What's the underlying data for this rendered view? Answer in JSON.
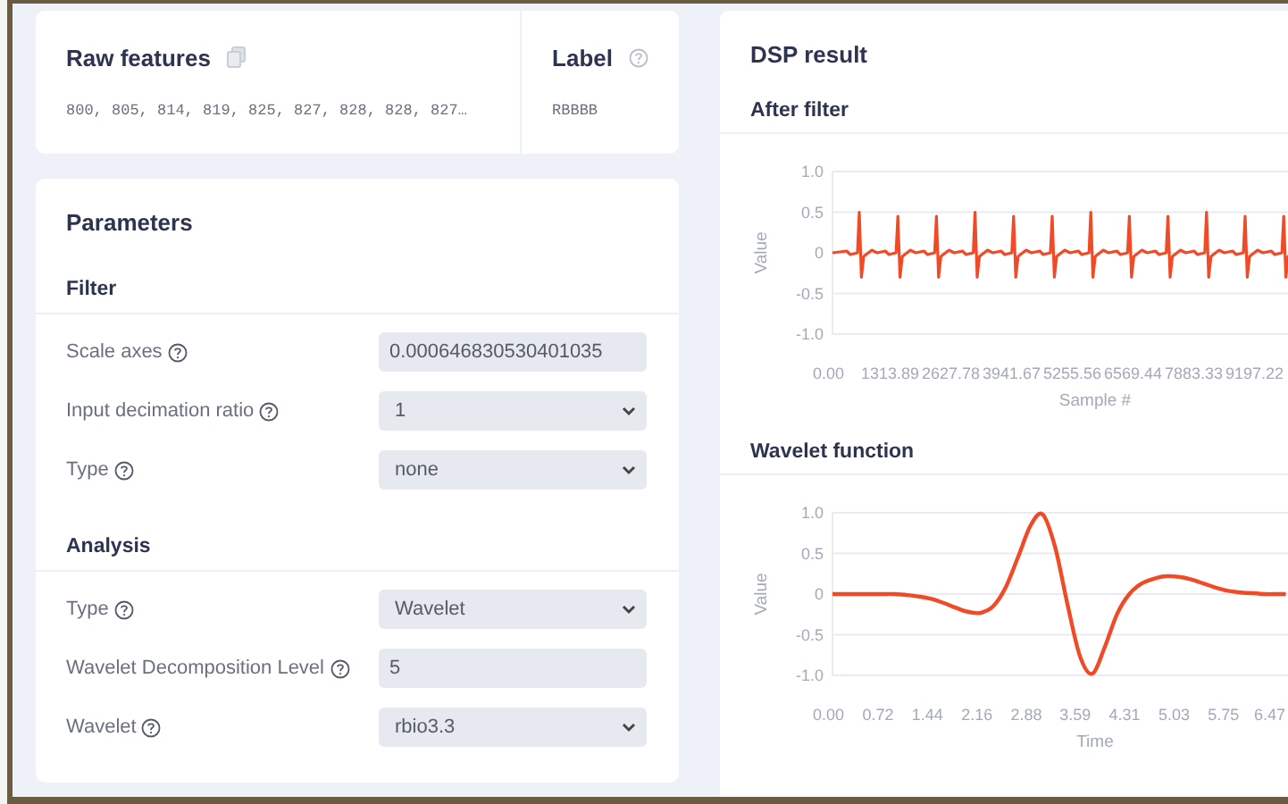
{
  "raw_features": {
    "title": "Raw features",
    "values": "800, 805, 814, 819, 825, 827, 828, 828, 827…"
  },
  "label": {
    "title": "Label",
    "value": "RBBBB"
  },
  "parameters": {
    "title": "Parameters",
    "sections": [
      {
        "title": "Filter",
        "fields": [
          {
            "label": "Scale axes",
            "kind": "input",
            "value": "0.000646830530401035"
          },
          {
            "label": "Input decimation ratio",
            "kind": "select",
            "value": "1"
          },
          {
            "label": "Type",
            "kind": "select",
            "value": "none"
          }
        ]
      },
      {
        "title": "Analysis",
        "fields": [
          {
            "label": "Type",
            "kind": "select",
            "value": "Wavelet"
          },
          {
            "label": "Wavelet Decomposition Level",
            "kind": "input",
            "value": "5"
          },
          {
            "label": "Wavelet",
            "kind": "select",
            "value": "rbio3.3"
          }
        ]
      }
    ]
  },
  "dsp_result": {
    "title": "DSP result",
    "charts": [
      {
        "title": "After filter",
        "kind": "ecg",
        "ylabel": "Value",
        "yticks": [
          "1.0",
          "0.5",
          "0",
          "-0.5",
          "-1.0"
        ],
        "xticks": [
          "0.00",
          "1313.89",
          "2627.78",
          "3941.67",
          "5255.56",
          "6569.44",
          "7883.33",
          "9197.22"
        ],
        "xlabel": "Sample #"
      },
      {
        "title": "Wavelet function",
        "chart_data": {
          "type": "line",
          "xlabel": "Time",
          "ylabel": "Value",
          "grid": true,
          "x": [
            0,
            0.18,
            0.36,
            0.54,
            0.72,
            0.9,
            1.08,
            1.26,
            1.44,
            1.62,
            1.8,
            1.98,
            2.16,
            2.34,
            2.52,
            2.7,
            2.88,
            3.06,
            3.24,
            3.42,
            3.6,
            3.78,
            3.96,
            4.14,
            4.32,
            4.5,
            4.68,
            4.86,
            5.04,
            5.22,
            5.4,
            5.58,
            5.76,
            5.94,
            6.12,
            6.3,
            6.48,
            6.6
          ],
          "series": [
            {
              "color": "#f04b26",
              "values": [
                0,
                0,
                0,
                0,
                0,
                0,
                -0.01,
                -0.03,
                -0.06,
                -0.11,
                -0.17,
                -0.22,
                -0.23,
                -0.15,
                0.08,
                0.45,
                0.84,
                0.98,
                0.58,
                -0.12,
                -0.76,
                -0.98,
                -0.66,
                -0.25,
                0,
                0.13,
                0.19,
                0.22,
                0.21,
                0.18,
                0.13,
                0.08,
                0.04,
                0.02,
                0.01,
                0,
                0,
                0
              ]
            }
          ],
          "xlim": [
            0,
            6.63
          ],
          "ylim": [
            -1,
            1
          ],
          "xticks": [
            {
              "value": 0,
              "label": "0.00"
            },
            {
              "value": 0.72,
              "label": "0.72"
            },
            {
              "value": 1.44,
              "label": "1.44"
            },
            {
              "value": 2.16,
              "label": "2.16"
            },
            {
              "value": 2.88,
              "label": "2.88"
            },
            {
              "value": 3.59,
              "label": "3.59"
            },
            {
              "value": 4.31,
              "label": "4.31"
            },
            {
              "value": 5.03,
              "label": "5.03"
            },
            {
              "value": 5.75,
              "label": "5.75"
            },
            {
              "value": 6.47,
              "label": "6.47"
            }
          ],
          "yticks": [
            {
              "value": 1,
              "label": "1.0"
            },
            {
              "value": 0.5,
              "label": "0.5"
            },
            {
              "value": 0,
              "label": "0"
            },
            {
              "value": -0.5,
              "label": "-0.5"
            },
            {
              "value": -1,
              "label": "-1.0"
            }
          ]
        }
      }
    ]
  }
}
